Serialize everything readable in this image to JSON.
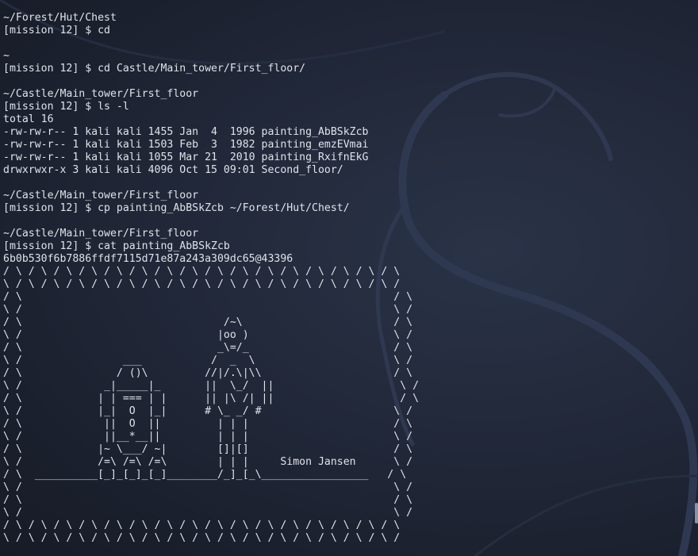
{
  "terminal": {
    "lines": [
      "~/Forest/Hut/Chest",
      "[mission 12] $ cd",
      "",
      "~",
      "[mission 12] $ cd Castle/Main_tower/First_floor/",
      "",
      "~/Castle/Main_tower/First_floor",
      "[mission 12] $ ls -l",
      "total 16",
      "-rw-rw-r-- 1 kali kali 1455 Jan  4  1996 painting_AbBSkZcb",
      "-rw-rw-r-- 1 kali kali 1503 Feb  3  1982 painting_emzEVmai",
      "-rw-rw-r-- 1 kali kali 1055 Mar 21  2010 painting_RxifnEkG",
      "drwxrwxr-x 3 kali kali 4096 Oct 15 09:01 Second_floor/",
      "",
      "~/Castle/Main_tower/First_floor",
      "[mission 12] $ cp painting_AbBSkZcb ~/Forest/Hut/Chest/",
      "",
      "~/Castle/Main_tower/First_floor",
      "[mission 12] $ cat painting_AbBSkZcb",
      "6b0b530f6b7886ffdf7115d71e87a243a309dc65@43396",
      "/ \\ / \\ / \\ / \\ / \\ / \\ / \\ / \\ / \\ / \\ / \\ / \\ / \\ / \\ / \\ / \\",
      "\\ / \\ / \\ / \\ / \\ / \\ / \\ / \\ / \\ / \\ / \\ / \\ / \\ / \\ / \\ / \\ /",
      "/ \\                                                           / \\",
      "\\ /                                                           \\ /",
      "/ \\                                /~\\                        / \\",
      "\\ /                               |oo )                       \\ /",
      "/ \\                               _\\=/_                       / \\",
      "\\ /                ___           /  _  \\                      \\ /",
      "/ \\               / ()\\         //|/.\\|\\\\                     / \\",
      "\\ /             _|_____|_       ||  \\_/  ||                    \\ /",
      "/ \\            | | === | |      || |\\ /| ||                    / \\",
      "\\ /            |_|  O  |_|      # \\_ _/ #                     \\ /",
      "/ \\             ||  O  ||         | | |                       / \\",
      "\\ /             ||__*__||         | | |                       \\ /",
      "/ \\            |~ \\___/ ~|        []|[]                       / \\",
      "\\ /            /=\\ /=\\ /=\\        | | |     Simon Jansen      \\ /",
      "/ \\  __________[_]_[_]_[_]________/_]_[_\\_________________   / \\",
      "\\ /                                                           \\ /",
      "/ \\                                                           / \\",
      "\\ /                                                           \\ /",
      "/ \\ / \\ / \\ / \\ / \\ / \\ / \\ / \\ / \\ / \\ / \\ / \\ / \\ / \\ / \\ / \\",
      "\\ / \\ / \\ / \\ / \\ / \\ / \\ / \\ / \\ / \\ / \\ / \\ / \\ / \\ / \\ / \\ /"
    ]
  },
  "colors": {
    "text": "#dfe3ea",
    "background": "#1c2230"
  },
  "decor": {
    "background_icon": "kali-dragon-icon"
  }
}
